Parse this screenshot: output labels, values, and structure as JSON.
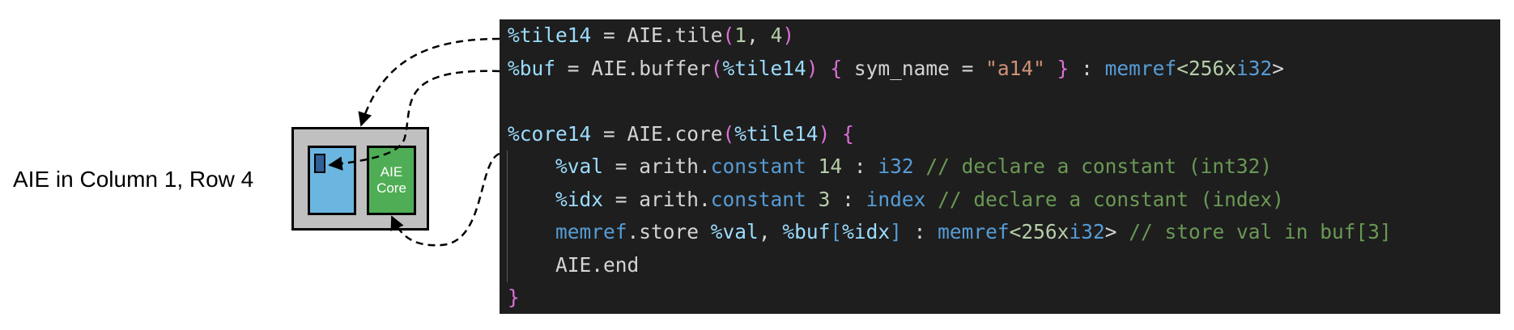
{
  "tile_label": "AIE in Column 1, Row 4",
  "core_label_line1": "AIE",
  "core_label_line2": "Core",
  "colors": {
    "code_background": "#1e1e1e",
    "memory_block": "#6bb6e0",
    "buffer_block": "#2f5f94",
    "core_block": "#4fae55",
    "tile_background": "#c0c0c0"
  },
  "code": {
    "line1": {
      "a": "%tile14",
      "b": " = AIE.tile",
      "c": "(",
      "d": "1",
      "e": ", ",
      "f": "4",
      "g": ")"
    },
    "line2": {
      "a": "%buf",
      "b": " = AIE.buffer",
      "c": "(",
      "d": "%tile14",
      "e": ") ",
      "f": "{",
      "g": " sym_name = ",
      "h": "\"a14\"",
      "i": " ",
      "j": "}",
      "k": " : ",
      "l": "memref",
      "m": "<256x",
      "n": "i32",
      "o": ">"
    },
    "line4": {
      "a": "%core14",
      "b": " = AIE.core",
      "c": "(",
      "d": "%tile14",
      "e": ") ",
      "f": "{"
    },
    "line5": {
      "a": "    ",
      "b": "%val",
      "c": " = arith.",
      "d": "constant",
      "e": " ",
      "f": "14",
      "g": " : ",
      "h": "i32",
      "i": " // declare a constant (int32)"
    },
    "line6": {
      "a": "    ",
      "b": "%idx",
      "c": " = arith.",
      "d": "constant",
      "e": " ",
      "f": "3",
      "g": " : ",
      "h": "index",
      "i": " // declare a constant (index)"
    },
    "line7": {
      "a": "    ",
      "b": "memref",
      "c": ".store ",
      "d": "%val",
      "e": ", ",
      "f": "%buf",
      "g": "[",
      "h": "%idx",
      "i": "]",
      "j": " : ",
      "k": "memref",
      "l": "<256x",
      "m": "i32",
      "n": ">",
      "o": " // store val in buf[3]"
    },
    "line8": {
      "a": "    AIE.end"
    },
    "line9": {
      "a": "}"
    }
  }
}
